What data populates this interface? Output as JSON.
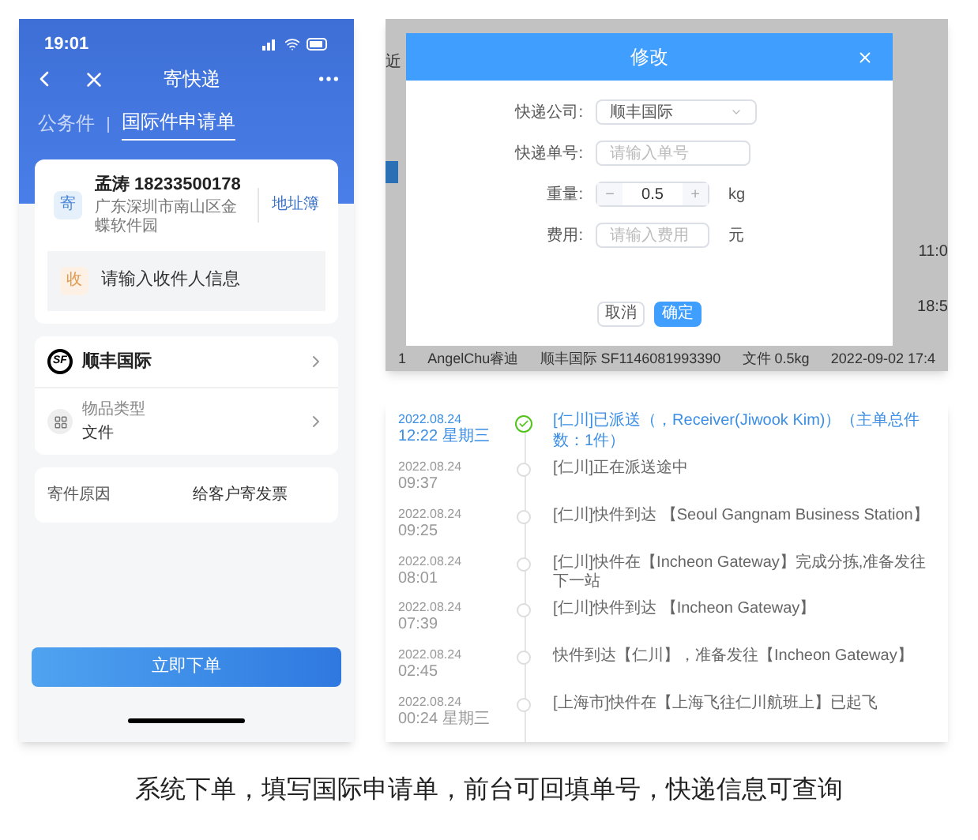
{
  "phone": {
    "status_time": "19:01",
    "nav_title": "寄快递",
    "tabs": [
      {
        "label": "公务件",
        "selected": false
      },
      {
        "label": "国际件申请单",
        "selected": true
      }
    ],
    "sender": {
      "badge": "寄",
      "name": "孟涛 18233500178",
      "address": "广东深圳市南山区金蝶软件园",
      "action": "地址簿"
    },
    "receiver": {
      "badge": "收",
      "prompt": "请输入收件人信息"
    },
    "carrier": {
      "logo": "SF",
      "name": "顺丰国际"
    },
    "item_type": {
      "label": "物品类型",
      "value": "文件"
    },
    "reason": {
      "label": "寄件原因",
      "value": "给客户寄发票"
    },
    "submit": "立即下单"
  },
  "admin": {
    "background": {
      "filter": "近",
      "times": [
        "11:0",
        "18:5"
      ],
      "row": [
        "1",
        "AngelChu睿迪",
        "顺丰国际 SF1146081993390",
        "文件 0.5kg",
        "2022-09-02 17:4"
      ]
    },
    "dialog": {
      "title": "修改",
      "fields": [
        {
          "kind": "select",
          "label": "快递公司:",
          "value": "顺丰国际"
        },
        {
          "kind": "text",
          "label": "快递单号:",
          "placeholder": "请输入单号"
        },
        {
          "kind": "stepper",
          "label": "重量:",
          "value": "0.5",
          "minus": "−",
          "plus": "+",
          "unit": "kg"
        },
        {
          "kind": "text",
          "label": "费用:",
          "placeholder": "请输入费用",
          "unit": "元"
        }
      ],
      "buttons": [
        {
          "label": "取消",
          "primary": false
        },
        {
          "label": "确定",
          "primary": true
        }
      ]
    }
  },
  "tracking": [
    {
      "date": "2022.08.24",
      "time": "12:22 星期三",
      "text": "[仁川]已派送（，Receiver(Jiwook Kim)）（主单总件数：1件）",
      "current": true
    },
    {
      "date": "2022.08.24",
      "time": "09:37",
      "text": "[仁川]正在派送途中",
      "current": false
    },
    {
      "date": "2022.08.24",
      "time": "09:25",
      "text": "[仁川]快件到达 【Seoul Gangnam Business Station】",
      "current": false
    },
    {
      "date": "2022.08.24",
      "time": "08:01",
      "text": "[仁川]快件在【Incheon Gateway】完成分拣,准备发往下一站",
      "current": false
    },
    {
      "date": "2022.08.24",
      "time": "07:39",
      "text": "[仁川]快件到达 【Incheon Gateway】",
      "current": false
    },
    {
      "date": "2022.08.24",
      "time": "02:45",
      "text": "快件到达【仁川】，准备发往【Incheon Gateway】",
      "current": false
    },
    {
      "date": "2022.08.24",
      "time": "00:24 星期三",
      "text": "[上海市]快件在【上海飞往仁川航班上】已起飞",
      "current": false
    }
  ],
  "caption": "系统下单，填写国际申请单，前台可回填单号，快递信息可查询"
}
